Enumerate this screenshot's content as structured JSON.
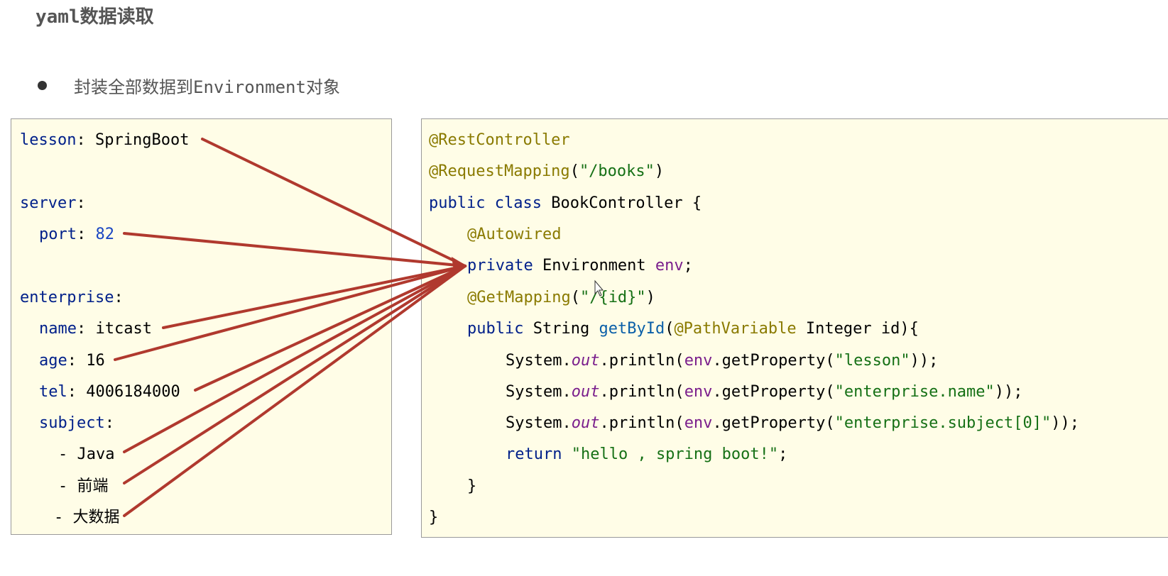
{
  "title": "yaml数据读取",
  "bullet": "封装全部数据到Environment对象",
  "yaml": {
    "lesson_key": "lesson",
    "lesson_val": "SpringBoot",
    "server_key": "server",
    "port_key": "port",
    "port_val": "82",
    "enterprise_key": "enterprise",
    "name_key": "name",
    "name_val": "itcast",
    "age_key": "age",
    "age_val": "16",
    "tel_key": "tel",
    "tel_val": "4006184000",
    "subject_key": "subject",
    "subject_items": [
      "Java",
      "前端",
      "大数据"
    ]
  },
  "code": {
    "ann_rest": "@RestController",
    "ann_req": "@RequestMapping",
    "req_path": "\"/books\"",
    "kw_public": "public",
    "kw_class": "class",
    "class_name": "BookController",
    "ann_autowired": "@Autowired",
    "kw_private": "private",
    "type_env": "Environment",
    "var_env": "env",
    "ann_get": "@GetMapping",
    "get_path": "\"/{id}\"",
    "type_string": "String",
    "method_name": "getById",
    "ann_path_var": "@PathVariable",
    "type_integer": "Integer",
    "param_id": "id",
    "sys": "System.",
    "out": "out",
    "println": ".println(",
    "get_property": ".getProperty(",
    "prop_lesson": "\"lesson\"",
    "prop_name": "\"enterprise.name\"",
    "prop_subject": "\"enterprise.subject[0]\"",
    "kw_return": "return",
    "return_str": "\"hello , spring boot!\""
  },
  "colors": {
    "panel_bg": "#fffde7",
    "arrow": "#b0392e",
    "annotation": "#8a7a00",
    "keyword": "#00208a",
    "string": "#157015"
  }
}
